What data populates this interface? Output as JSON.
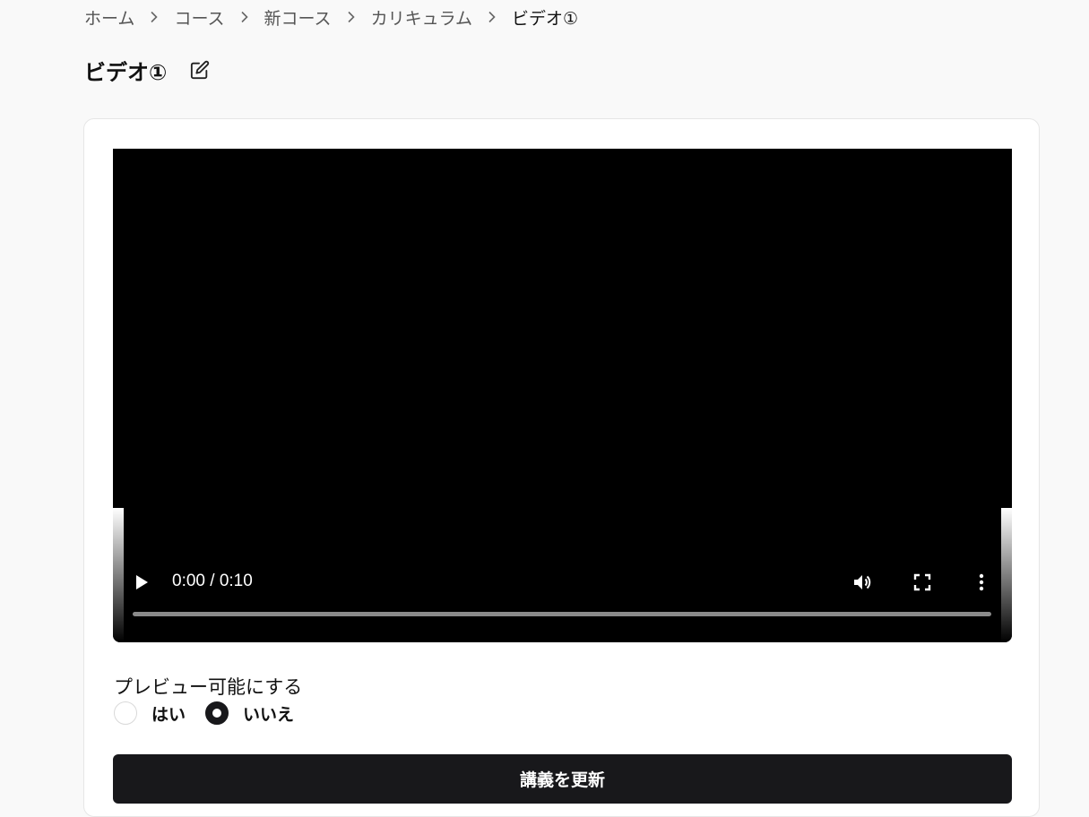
{
  "breadcrumb": {
    "items": [
      {
        "label": "ホーム"
      },
      {
        "label": "コース"
      },
      {
        "label": "新コース"
      },
      {
        "label": "カリキュラム"
      }
    ],
    "current": "ビデオ①"
  },
  "page": {
    "title": "ビデオ①"
  },
  "video": {
    "current_time": "0:00",
    "duration": "0:10",
    "time_display": "0:00 / 0:10",
    "progress": 0
  },
  "preview": {
    "label": "プレビュー可能にする",
    "options": [
      {
        "label": "はい",
        "selected": false
      },
      {
        "label": "いいえ",
        "selected": true
      }
    ]
  },
  "actions": {
    "submit_label": "講義を更新"
  },
  "colors": {
    "primary": "#18181b",
    "background": "#f9f9f9",
    "card": "#ffffff"
  }
}
